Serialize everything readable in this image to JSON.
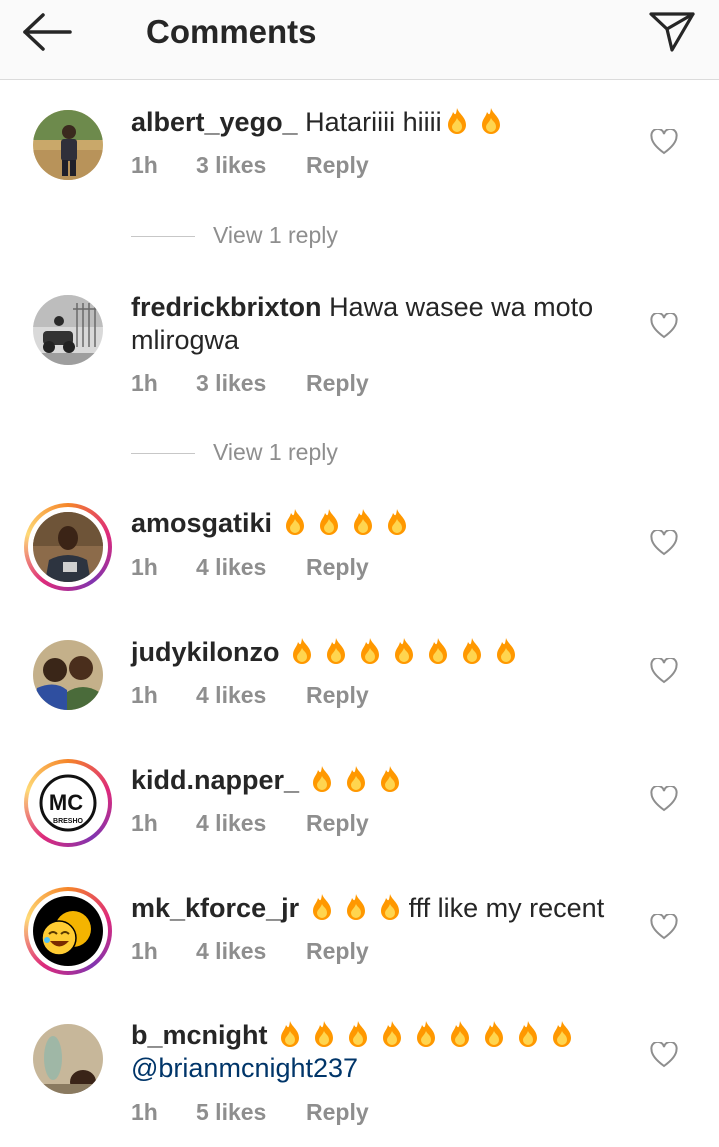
{
  "header": {
    "title": "Comments",
    "back_icon": "arrow-left-icon",
    "send_icon": "paper-plane-icon"
  },
  "comments": [
    {
      "username": "albert_yego_",
      "text": "Hatariiii hiiii",
      "fires": 2,
      "time": "1h",
      "likes": "3 likes",
      "reply": "Reply",
      "view_replies": "View 1 reply",
      "avatar_icon": "user-photo-avatar"
    },
    {
      "username": "fredrickbrixton",
      "text": "Hawa wasee wa moto mlirogwa",
      "fires": 0,
      "time": "1h",
      "likes": "3 likes",
      "reply": "Reply",
      "view_replies": "View 1 reply",
      "avatar_icon": "user-photo-avatar"
    },
    {
      "username": "amosgatiki",
      "text": "",
      "fires": 4,
      "time": "1h",
      "likes": "4 likes",
      "reply": "Reply",
      "avatar_icon": "user-photo-avatar-story-ring"
    },
    {
      "username": "judykilonzo",
      "text": "",
      "fires": 7,
      "time": "1h",
      "likes": "4 likes",
      "reply": "Reply",
      "avatar_icon": "user-photo-avatar"
    },
    {
      "username": "kidd.napper_",
      "text": "",
      "fires": 3,
      "time": "1h",
      "likes": "4 likes",
      "reply": "Reply",
      "avatar_icon": "mc-logo-avatar-story-ring",
      "avatar_logo_text": "MC",
      "avatar_logo_subtext": "BRESHO"
    },
    {
      "username": "mk_kforce_jr",
      "text": "fff like my recent",
      "fires": 3,
      "time": "1h",
      "likes": "4 likes",
      "reply": "Reply",
      "avatar_icon": "laughing-face-avatar-story-ring"
    },
    {
      "username": "b_mcnight",
      "text": "",
      "fires": 9,
      "mention": "@brianmcnight237",
      "time": "1h",
      "likes": "5 likes",
      "reply": "Reply",
      "avatar_icon": "user-photo-avatar"
    }
  ],
  "colors": {
    "text": "#262626",
    "meta": "#8e8e8e",
    "mention": "#003569",
    "header_bg": "#fafafa",
    "fire": "#ff9800"
  }
}
